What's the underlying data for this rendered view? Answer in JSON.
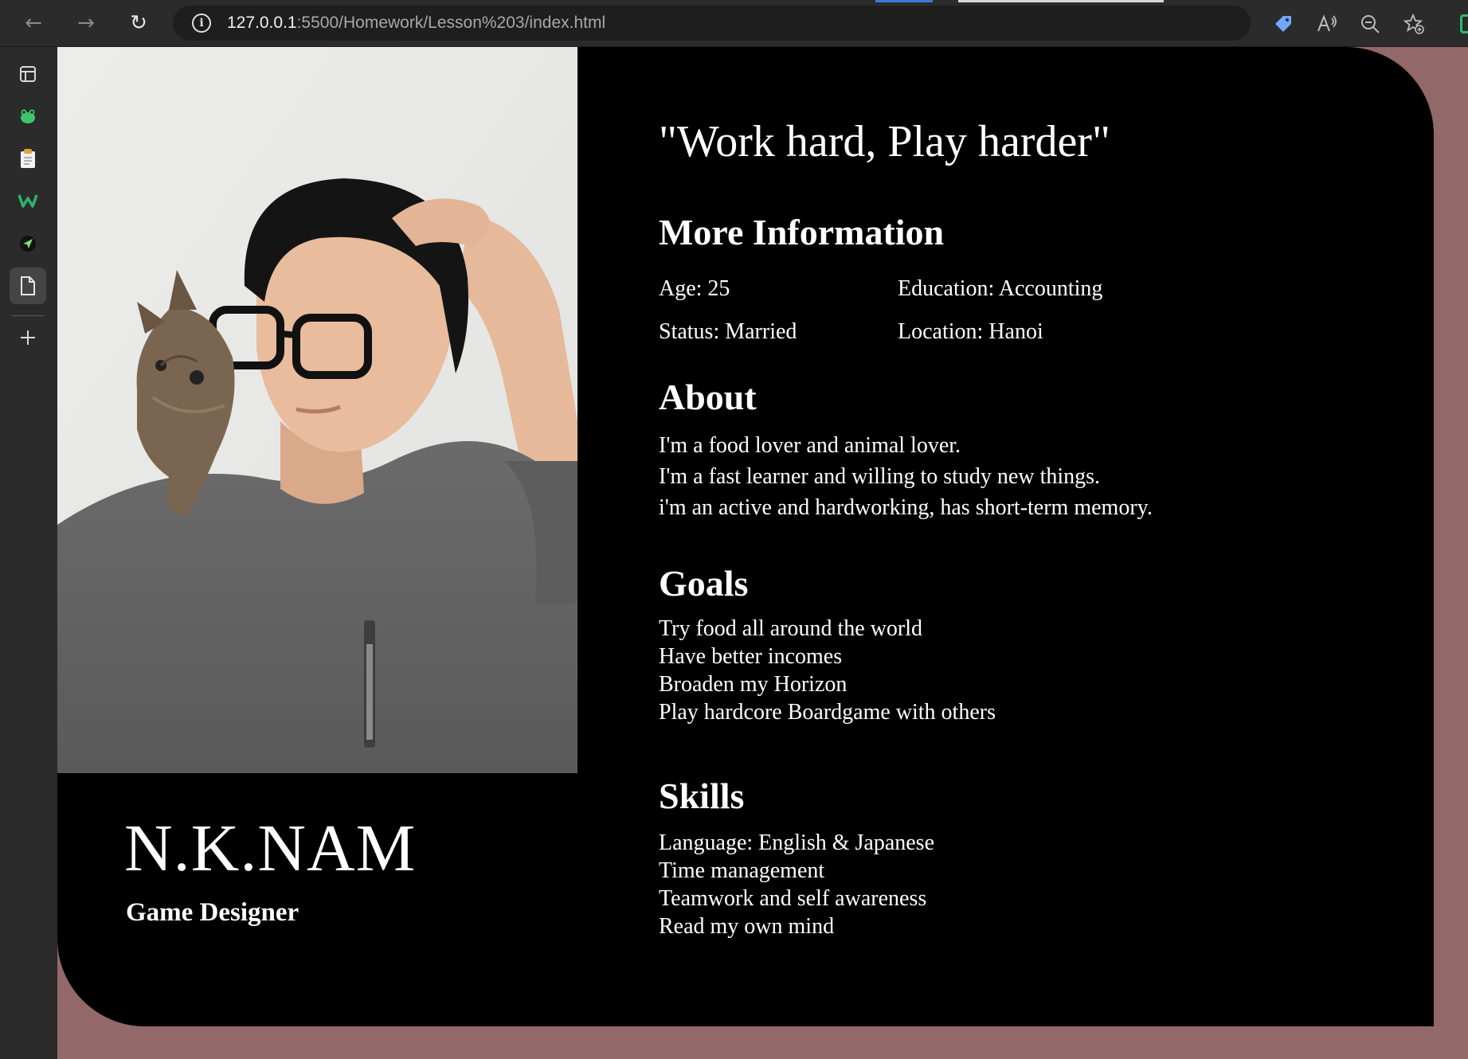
{
  "browser": {
    "url_host": "127.0.0.1",
    "url_rest": ":5500/Homework/Lesson%203/index.html"
  },
  "profile": {
    "name": "N.K.NAM",
    "role": "Game Designer",
    "quote": "\"Work hard, Play harder\"",
    "more_info": {
      "heading": "More Information",
      "age": "Age: 25",
      "education": "Education: Accounting",
      "status": "Status: Married",
      "location": "Location: Hanoi"
    },
    "about": {
      "heading": "About",
      "lines": [
        "I'm a food lover and animal lover.",
        "I'm a fast learner and willing to study new things.",
        "i'm an active and hardworking, has short-term memory."
      ]
    },
    "goals": {
      "heading": "Goals",
      "items": [
        "Try food all around the world",
        "Have better incomes",
        "Broaden my Horizon",
        "Play hardcore Boardgame with others"
      ]
    },
    "skills": {
      "heading": "Skills",
      "items": [
        "Language: English & Japanese",
        "Time management",
        "Teamwork and self awareness",
        "Read my own mind"
      ]
    }
  },
  "colors": {
    "page_background": "#926868",
    "card_background": "#000000",
    "chrome_background": "#2b2b2b"
  }
}
